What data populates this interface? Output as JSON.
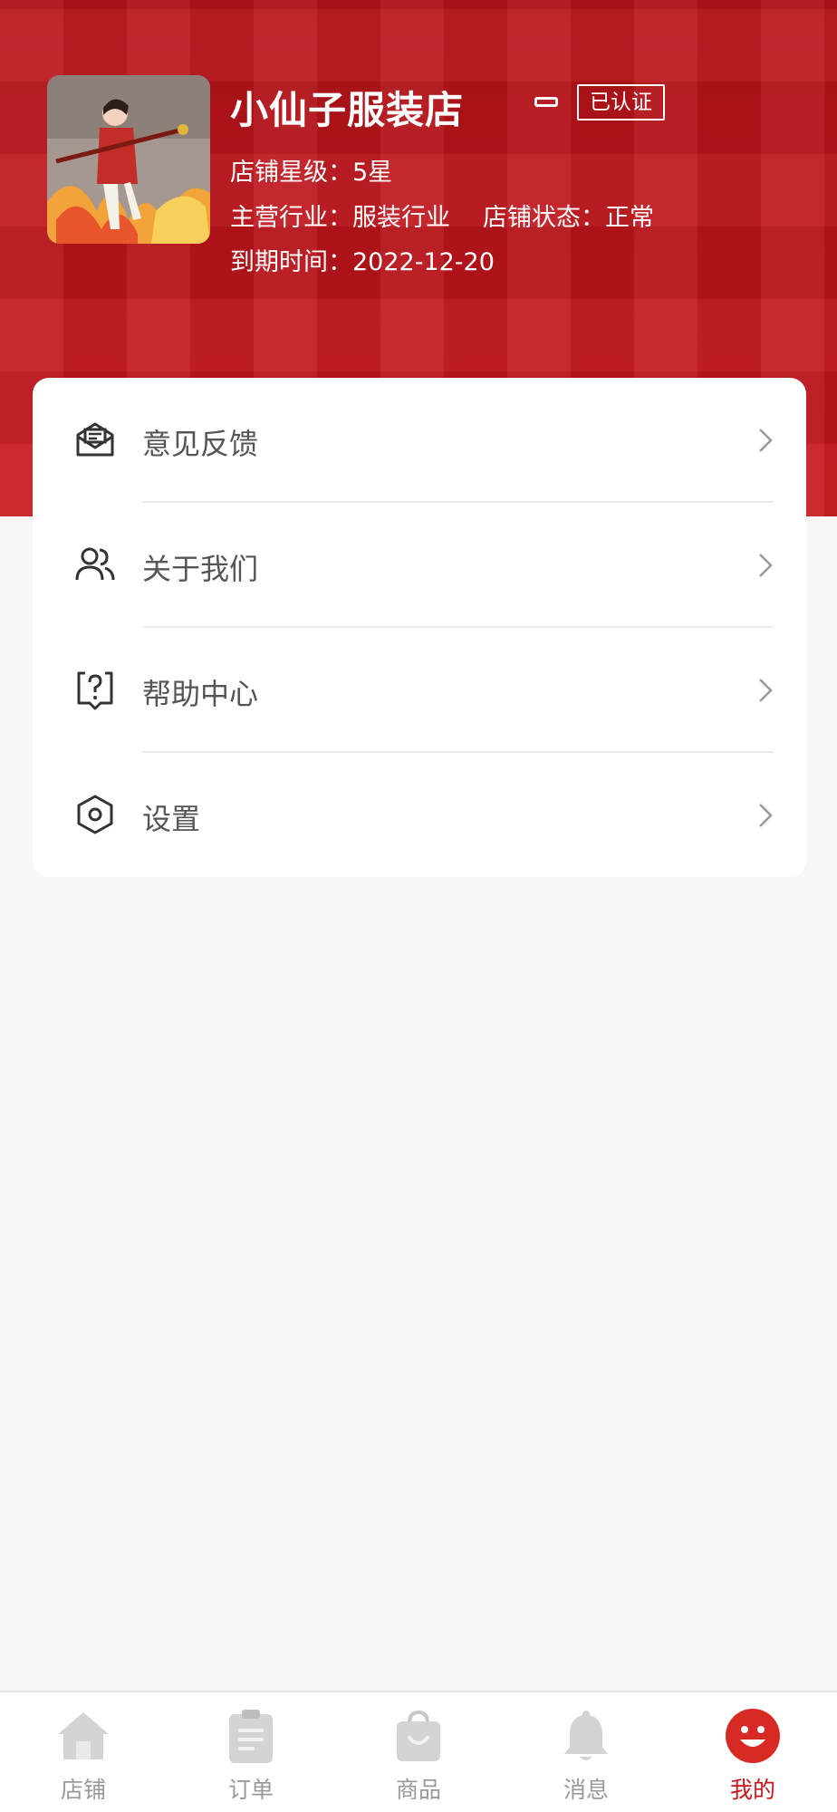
{
  "shop": {
    "name": "小仙子服装店",
    "badge": "已认证",
    "rating_line": "店铺星级：5星",
    "industry_line": "主营行业：服装行业",
    "status_line": "店铺状态：正常",
    "expiry_line": "到期时间：2022-12-20"
  },
  "menu": [
    {
      "label": "意见反馈",
      "icon": "feedback-envelope-icon"
    },
    {
      "label": "关于我们",
      "icon": "users-icon"
    },
    {
      "label": "帮助中心",
      "icon": "help-question-icon"
    },
    {
      "label": "设置",
      "icon": "settings-hexagon-icon"
    }
  ],
  "tabs": [
    {
      "label": "店铺",
      "icon": "home-icon"
    },
    {
      "label": "订单",
      "icon": "order-clipboard-icon"
    },
    {
      "label": "商品",
      "icon": "shopping-bag-icon"
    },
    {
      "label": "消息",
      "icon": "bell-icon"
    },
    {
      "label": "我的",
      "icon": "smiley-profile-icon",
      "active": true
    }
  ],
  "colors": {
    "brand_red": "#c8161c",
    "background": "#f7f7f7",
    "tab_inactive": "#999999"
  }
}
